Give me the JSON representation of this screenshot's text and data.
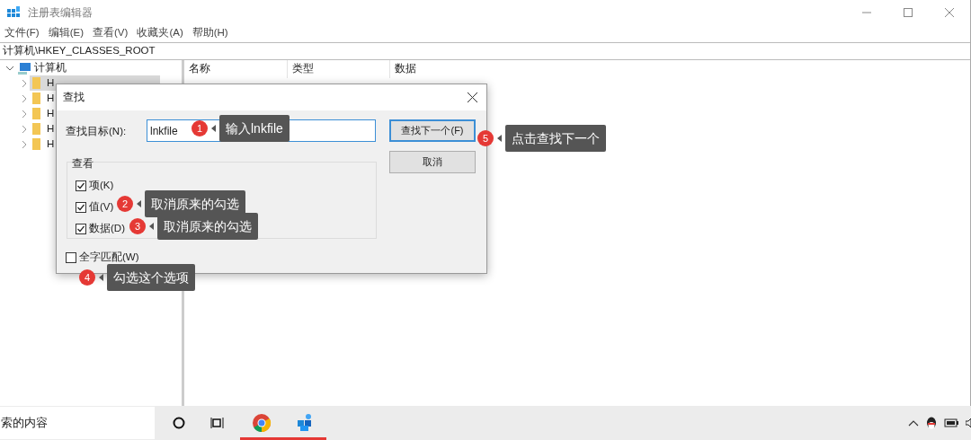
{
  "window": {
    "title": "注册表编辑器"
  },
  "menu": [
    "文件(F)",
    "编辑(E)",
    "查看(V)",
    "收藏夹(A)",
    "帮助(H)"
  ],
  "address": "计算机\\HKEY_CLASSES_ROOT",
  "tree": {
    "label": "计算机",
    "expanded": true,
    "children": [
      {
        "label": "H",
        "selected": true
      },
      {
        "label": "H",
        "selected": false
      },
      {
        "label": "H",
        "selected": false
      },
      {
        "label": "H",
        "selected": false
      },
      {
        "label": "H",
        "selected": false
      }
    ]
  },
  "list": {
    "columns": [
      "名称",
      "类型",
      "数据"
    ]
  },
  "dialog": {
    "title": "查找",
    "find_label": "查找目标(N):",
    "find_value": "lnkfile",
    "next_button": "查找下一个(F)",
    "cancel_button": "取消",
    "group_title": "查看",
    "options": [
      {
        "label": "项(K)",
        "checked": true
      },
      {
        "label": "值(V)",
        "checked": true
      },
      {
        "label": "数据(D)",
        "checked": true
      }
    ],
    "whole_word": {
      "label": "全字匹配(W)",
      "checked": false
    }
  },
  "annotations": [
    {
      "number": "1",
      "text": "输入lnkfile"
    },
    {
      "number": "2",
      "text": "取消原来的勾选"
    },
    {
      "number": "3",
      "text": "取消原来的勾选"
    },
    {
      "number": "4",
      "text": "勾选这个选项"
    },
    {
      "number": "5",
      "text": "点击查找下一个"
    }
  ],
  "taskbar": {
    "search_text": "索的内容",
    "apps": [
      {
        "kind": "cortana",
        "active": false
      },
      {
        "kind": "taskview",
        "active": false
      },
      {
        "kind": "chrome",
        "active": true
      },
      {
        "kind": "regedit",
        "active": true
      }
    ]
  }
}
